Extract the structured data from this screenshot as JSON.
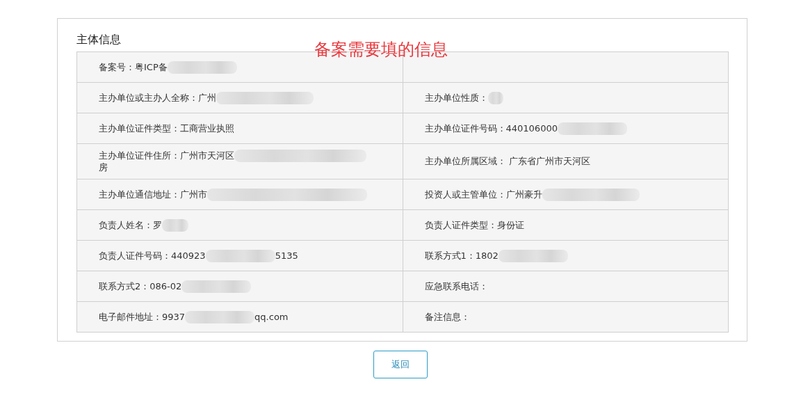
{
  "panel": {
    "title": "主体信息",
    "annotation": "备案需要填的信息"
  },
  "rows": [
    [
      {
        "parts": [
          {
            "kind": "text",
            "text": "备案号：粤ICP备"
          },
          {
            "kind": "blur"
          }
        ]
      },
      {}
    ],
    [
      {
        "parts": [
          {
            "kind": "text",
            "text": "主办单位或主办人全称：广州"
          },
          {
            "kind": "blur"
          }
        ]
      },
      {
        "parts": [
          {
            "kind": "text",
            "text": "主办单位性质："
          },
          {
            "kind": "blur"
          }
        ]
      }
    ],
    [
      {
        "parts": [
          {
            "kind": "text",
            "text": "主办单位证件类型：工商营业执照"
          }
        ]
      },
      {
        "parts": [
          {
            "kind": "text",
            "text": "主办单位证件号码：440106000"
          },
          {
            "kind": "blur"
          }
        ]
      }
    ],
    [
      {
        "parts": [
          {
            "kind": "text",
            "text": "主办单位证件住所：广州市天河区"
          },
          {
            "kind": "blur"
          },
          {
            "kind": "break"
          },
          {
            "kind": "text",
            "text": "房"
          }
        ]
      },
      {
        "parts": [
          {
            "kind": "text",
            "text": "主办单位所属区域：  广东省广州市天河区"
          }
        ]
      }
    ],
    [
      {
        "parts": [
          {
            "kind": "text",
            "text": "主办单位通信地址：广州市"
          },
          {
            "kind": "blur"
          }
        ]
      },
      {
        "parts": [
          {
            "kind": "text",
            "text": "投资人或主管单位：广州豪升"
          },
          {
            "kind": "blur"
          }
        ]
      }
    ],
    [
      {
        "parts": [
          {
            "kind": "text",
            "text": "负责人姓名：罗"
          },
          {
            "kind": "blur"
          }
        ]
      },
      {
        "parts": [
          {
            "kind": "text",
            "text": "负责人证件类型：身份证"
          }
        ]
      }
    ],
    [
      {
        "parts": [
          {
            "kind": "text",
            "text": "负责人证件号码：440923"
          },
          {
            "kind": "blur"
          },
          {
            "kind": "text",
            "text": "5135"
          }
        ]
      },
      {
        "parts": [
          {
            "kind": "text",
            "text": "联系方式1：1802"
          },
          {
            "kind": "blur"
          }
        ]
      }
    ],
    [
      {
        "parts": [
          {
            "kind": "text",
            "text": "联系方式2：086-02"
          },
          {
            "kind": "blur"
          }
        ]
      },
      {
        "parts": [
          {
            "kind": "text",
            "text": "应急联系电话："
          }
        ]
      }
    ],
    [
      {
        "parts": [
          {
            "kind": "text",
            "text": "电子邮件地址：9937"
          },
          {
            "kind": "blur"
          },
          {
            "kind": "text",
            "text": "qq.com"
          }
        ]
      },
      {
        "parts": [
          {
            "kind": "text",
            "text": "备注信息："
          }
        ]
      }
    ]
  ],
  "buttons": [
    {
      "label": "返回"
    }
  ]
}
